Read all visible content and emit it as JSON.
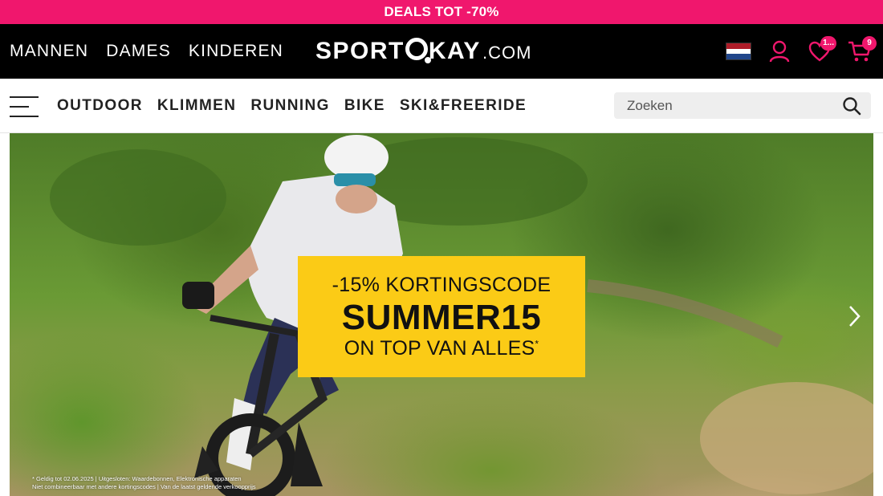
{
  "promo_bar": {
    "text": "DEALS TOT -70%"
  },
  "header": {
    "gender_nav": [
      "MANNEN",
      "DAMES",
      "KINDEREN"
    ],
    "logo": {
      "part1": "SPORT",
      "part2": "KAY",
      "domain": ".COM"
    },
    "icons": {
      "flag": "netherlands-flag",
      "account": "user-icon",
      "wishlist": {
        "icon": "heart-icon",
        "badge": "1..."
      },
      "cart": {
        "icon": "cart-icon",
        "badge": "9"
      }
    }
  },
  "category_nav": {
    "items": [
      "OUTDOOR",
      "KLIMMEN",
      "RUNNING",
      "BIKE",
      "SKI&FREERIDE"
    ],
    "search": {
      "placeholder": "Zoeken"
    }
  },
  "hero": {
    "promo": {
      "line1": "-15% KORTINGSCODE",
      "code": "SUMMER15",
      "line3": "ON TOP VAN ALLES",
      "asterisk": "*"
    },
    "disclaimer_line1": "* Geldig tot 02.06.2025 | Uitgesloten: Waardebonnen, Elektronische apparaten",
    "disclaimer_line2": "Niet combineerbaar met andere kortingscodes | Van de laatst geldende verkoopprijs"
  },
  "colors": {
    "accent": "#f0176d",
    "promo_card": "#fbcb16",
    "header_bg": "#000000"
  }
}
